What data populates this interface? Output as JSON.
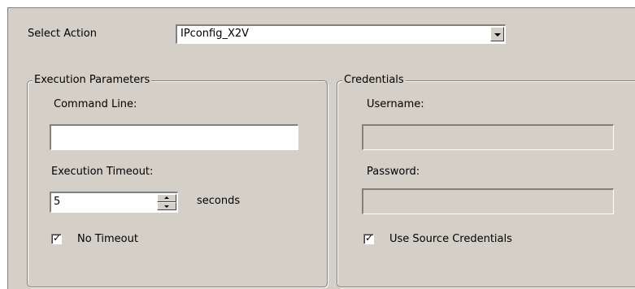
{
  "select_action": {
    "label": "Select Action",
    "value": "IPconfig_X2V"
  },
  "execution_parameters": {
    "title": "Execution Parameters",
    "command_line_label": "Command Line:",
    "command_line_value": "",
    "timeout_label": "Execution Timeout:",
    "timeout_value": "5",
    "timeout_unit": "seconds",
    "no_timeout_label": "No Timeout",
    "no_timeout_checked": true
  },
  "credentials": {
    "title": "Credentials",
    "username_label": "Username:",
    "username_value": "",
    "password_label": "Password:",
    "password_value": "",
    "use_source_label": "Use Source Credentials",
    "use_source_checked": true
  },
  "colors": {
    "dialog_bg": "#d4d0c8",
    "field_bg": "#ffffff",
    "disabled_field_bg": "#d4d0c8"
  }
}
